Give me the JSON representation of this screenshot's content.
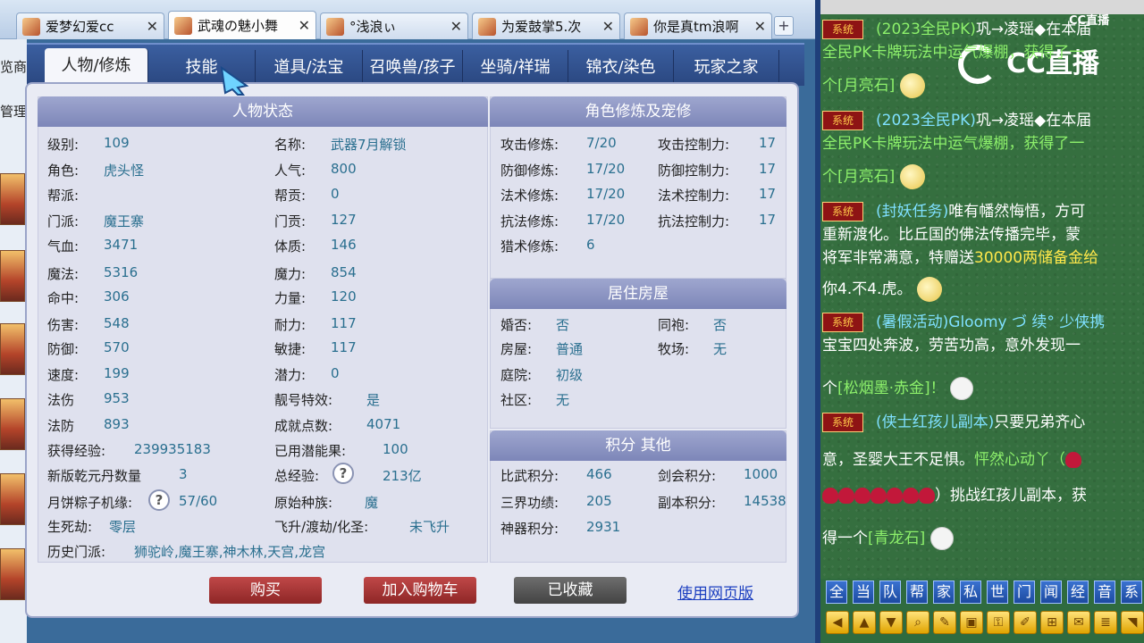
{
  "browser_tabs": [
    {
      "label": "爱梦幻爱cc",
      "close": "✕",
      "active": false
    },
    {
      "label": "武魂の魅小舞",
      "close": "✕",
      "active": true
    },
    {
      "label": "°浅浪ぃ",
      "close": "✕",
      "active": false
    },
    {
      "label": "为爱鼓掌5.次",
      "close": "✕",
      "active": false
    },
    {
      "label": "你是真tm浪啊",
      "close": "✕",
      "active": false
    }
  ],
  "new_tab": "+",
  "left_strip": {
    "text1": "览商",
    "text2": "管理"
  },
  "game_nav": [
    "人物/修炼",
    "技能",
    "道具/法宝",
    "召唤兽/孩子",
    "坐骑/祥瑞",
    "锦衣/染色",
    "玩家之家"
  ],
  "status": {
    "title": "人物状态",
    "left": [
      {
        "label": "级别:",
        "value": "109"
      },
      {
        "label": "角色:",
        "value": "虎头怪"
      },
      {
        "label": "帮派:",
        "value": ""
      },
      {
        "label": "门派:",
        "value": "魔王寨"
      },
      {
        "label": "气血:",
        "value": "3471"
      },
      {
        "label": "魔法:",
        "value": "5316"
      },
      {
        "label": "命中:",
        "value": "306"
      },
      {
        "label": "伤害:",
        "value": "548"
      },
      {
        "label": "防御:",
        "value": "570"
      },
      {
        "label": "速度:",
        "value": "199"
      },
      {
        "label": "法伤",
        "value": "953"
      },
      {
        "label": "法防",
        "value": "893"
      },
      {
        "label": "获得经验:",
        "value": "239935183"
      },
      {
        "label": "新版乾元丹数量",
        "value": "3"
      },
      {
        "label": "月饼粽子机缘:",
        "value": "57/60"
      },
      {
        "label": "生死劫:",
        "value": "零层"
      }
    ],
    "right": [
      {
        "label": "名称:",
        "value": "武器7月解锁"
      },
      {
        "label": "人气:",
        "value": "800"
      },
      {
        "label": "帮贡:",
        "value": "0"
      },
      {
        "label": "门贡:",
        "value": "127"
      },
      {
        "label": "体质:",
        "value": "146"
      },
      {
        "label": "魔力:",
        "value": "854"
      },
      {
        "label": "力量:",
        "value": "120"
      },
      {
        "label": "耐力:",
        "value": "117"
      },
      {
        "label": "敏捷:",
        "value": "117"
      },
      {
        "label": "潜力:",
        "value": "0"
      },
      {
        "label": "靓号特效:",
        "value": "是"
      },
      {
        "label": "成就点数:",
        "value": "4071"
      },
      {
        "label": "已用潜能果:",
        "value": "100"
      },
      {
        "label": "总经验:",
        "value": "213亿"
      },
      {
        "label": "原始种族:",
        "value": "魔"
      },
      {
        "label": "飞升/渡劫/化圣:",
        "value": "未飞升"
      }
    ],
    "history_label": "历史门派:",
    "history_value": "狮驼岭,魔王寨,神木林,天宫,龙宫",
    "help": "?"
  },
  "cultivation": {
    "title": "角色修炼及宠修",
    "rows": [
      {
        "l1": "攻击修炼:",
        "v1": "7/20",
        "l2": "攻击控制力:",
        "v2": "17"
      },
      {
        "l1": "防御修炼:",
        "v1": "17/20",
        "l2": "防御控制力:",
        "v2": "17"
      },
      {
        "l1": "法术修炼:",
        "v1": "17/20",
        "l2": "法术控制力:",
        "v2": "17"
      },
      {
        "l1": "抗法修炼:",
        "v1": "17/20",
        "l2": "抗法控制力:",
        "v2": "17"
      },
      {
        "l1": "猎术修炼:",
        "v1": "6",
        "l2": "",
        "v2": ""
      }
    ]
  },
  "housing": {
    "title": "居住房屋",
    "rows": [
      {
        "l1": "婚否:",
        "v1": "否",
        "l2": "同袍:",
        "v2": "否"
      },
      {
        "l1": "房屋:",
        "v1": "普通",
        "l2": "牧场:",
        "v2": "无"
      },
      {
        "l1": "庭院:",
        "v1": "初级",
        "l2": "",
        "v2": ""
      },
      {
        "l1": "社区:",
        "v1": "无",
        "l2": "",
        "v2": ""
      }
    ]
  },
  "points": {
    "title": "积分 其他",
    "rows": [
      {
        "l1": "比武积分:",
        "v1": "466",
        "l2": "剑会积分:",
        "v2": "1000"
      },
      {
        "l1": "三界功绩:",
        "v1": "205",
        "l2": "副本积分:",
        "v2": "14538"
      },
      {
        "l1": "神器积分:",
        "v1": "2931",
        "l2": "",
        "v2": ""
      }
    ]
  },
  "buttons": {
    "buy": "购买",
    "cart": "加入购物车",
    "fav": "已收藏",
    "web": "使用网页版"
  },
  "chat": {
    "badge": "系统",
    "top_logo": "CC直播",
    "logo": "CC直播",
    "lines": [
      {
        "a": "(2023全民PK)",
        "b": "巩→凌瑶◆在本届"
      },
      {
        "a": "全民PK卡牌玩法中运气爆棚，获得了一",
        "b": ""
      },
      {
        "a": "个",
        "b": "[月亮石]"
      },
      {
        "a": "(2023全民PK)",
        "b": "巩→凌瑶◆在本届"
      },
      {
        "a": "全民PK卡牌玩法中运气爆棚，获得了一",
        "b": ""
      },
      {
        "a": "个",
        "b": "[月亮石]"
      },
      {
        "a": "(封妖任务)",
        "b": "唯有幡然悔悟，方可"
      },
      {
        "a": "重新渡化。比丘国的佛法传播完毕，蒙",
        "b": ""
      },
      {
        "a": "将军非常满意，特赠送",
        "b": "30000两储备金给"
      },
      {
        "a": "你4.不4.虎。",
        "b": ""
      },
      {
        "a": "(暑假活动)",
        "b": "Gloomy づ 续° 少侠携"
      },
      {
        "a": "宝宝四处奔波，劳苦功高，意外发现一",
        "b": ""
      },
      {
        "a": "个",
        "b": "[松烟墨·赤金]！"
      },
      {
        "a": "(侠士红孩儿副本)",
        "b": "只要兄弟齐心"
      },
      {
        "a": "意，圣婴大王不足惧。",
        "b": "怦然心动丫（"
      },
      {
        "a": "）挑战红孩儿副本，获",
        "b": ""
      },
      {
        "a": "得一个",
        "b": "[青龙石]"
      }
    ],
    "channel_buttons": [
      "全",
      "当",
      "队",
      "帮",
      "家",
      "私",
      "世",
      "门",
      "闻",
      "经",
      "音",
      "系"
    ],
    "tools": [
      "◀",
      "▲",
      "▼",
      "⌕",
      "✎",
      "▣",
      "⚿",
      "✐",
      "⊞",
      "✉",
      "≣",
      "◥"
    ]
  },
  "colors": {
    "nav_bg": "#2a4780",
    "chat_bg": "#356f3f",
    "accent_val": "#2a6f8f",
    "red_btn": "#a83434"
  }
}
